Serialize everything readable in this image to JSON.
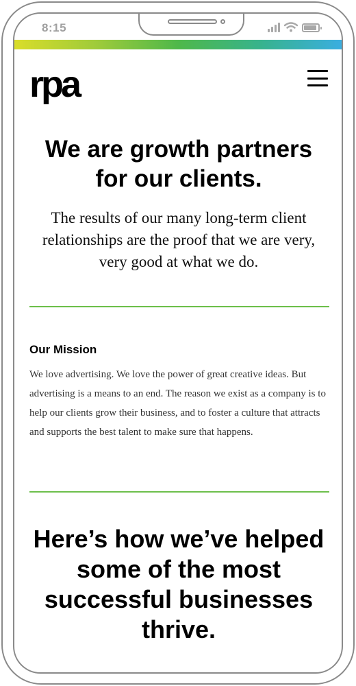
{
  "status_bar": {
    "time": "8:15",
    "icons": [
      "signal-icon",
      "wifi-icon",
      "battery-icon"
    ]
  },
  "brand": {
    "logo_text": "rpa",
    "gradient_colors": [
      "#d9dd2a",
      "#4fb84a",
      "#3aaee0"
    ],
    "accent_color": "#6cbf4a"
  },
  "header": {
    "menu_icon": "hamburger-menu-icon"
  },
  "hero": {
    "heading": "We are growth partners for our clients.",
    "subheading": "The results of our many long-term client relationships are the proof that we are very, very good at what we do."
  },
  "mission": {
    "heading": "Our Mission",
    "body": "We love advertising. We love the power of great creative ideas. But advertising is a means to an end. The reason we exist as a company is to help our clients grow their business, and to foster a culture that attracts and supports the best talent to make sure that happens."
  },
  "closing": {
    "heading": "Here’s how we’ve helped some of the most successful businesses thrive."
  }
}
